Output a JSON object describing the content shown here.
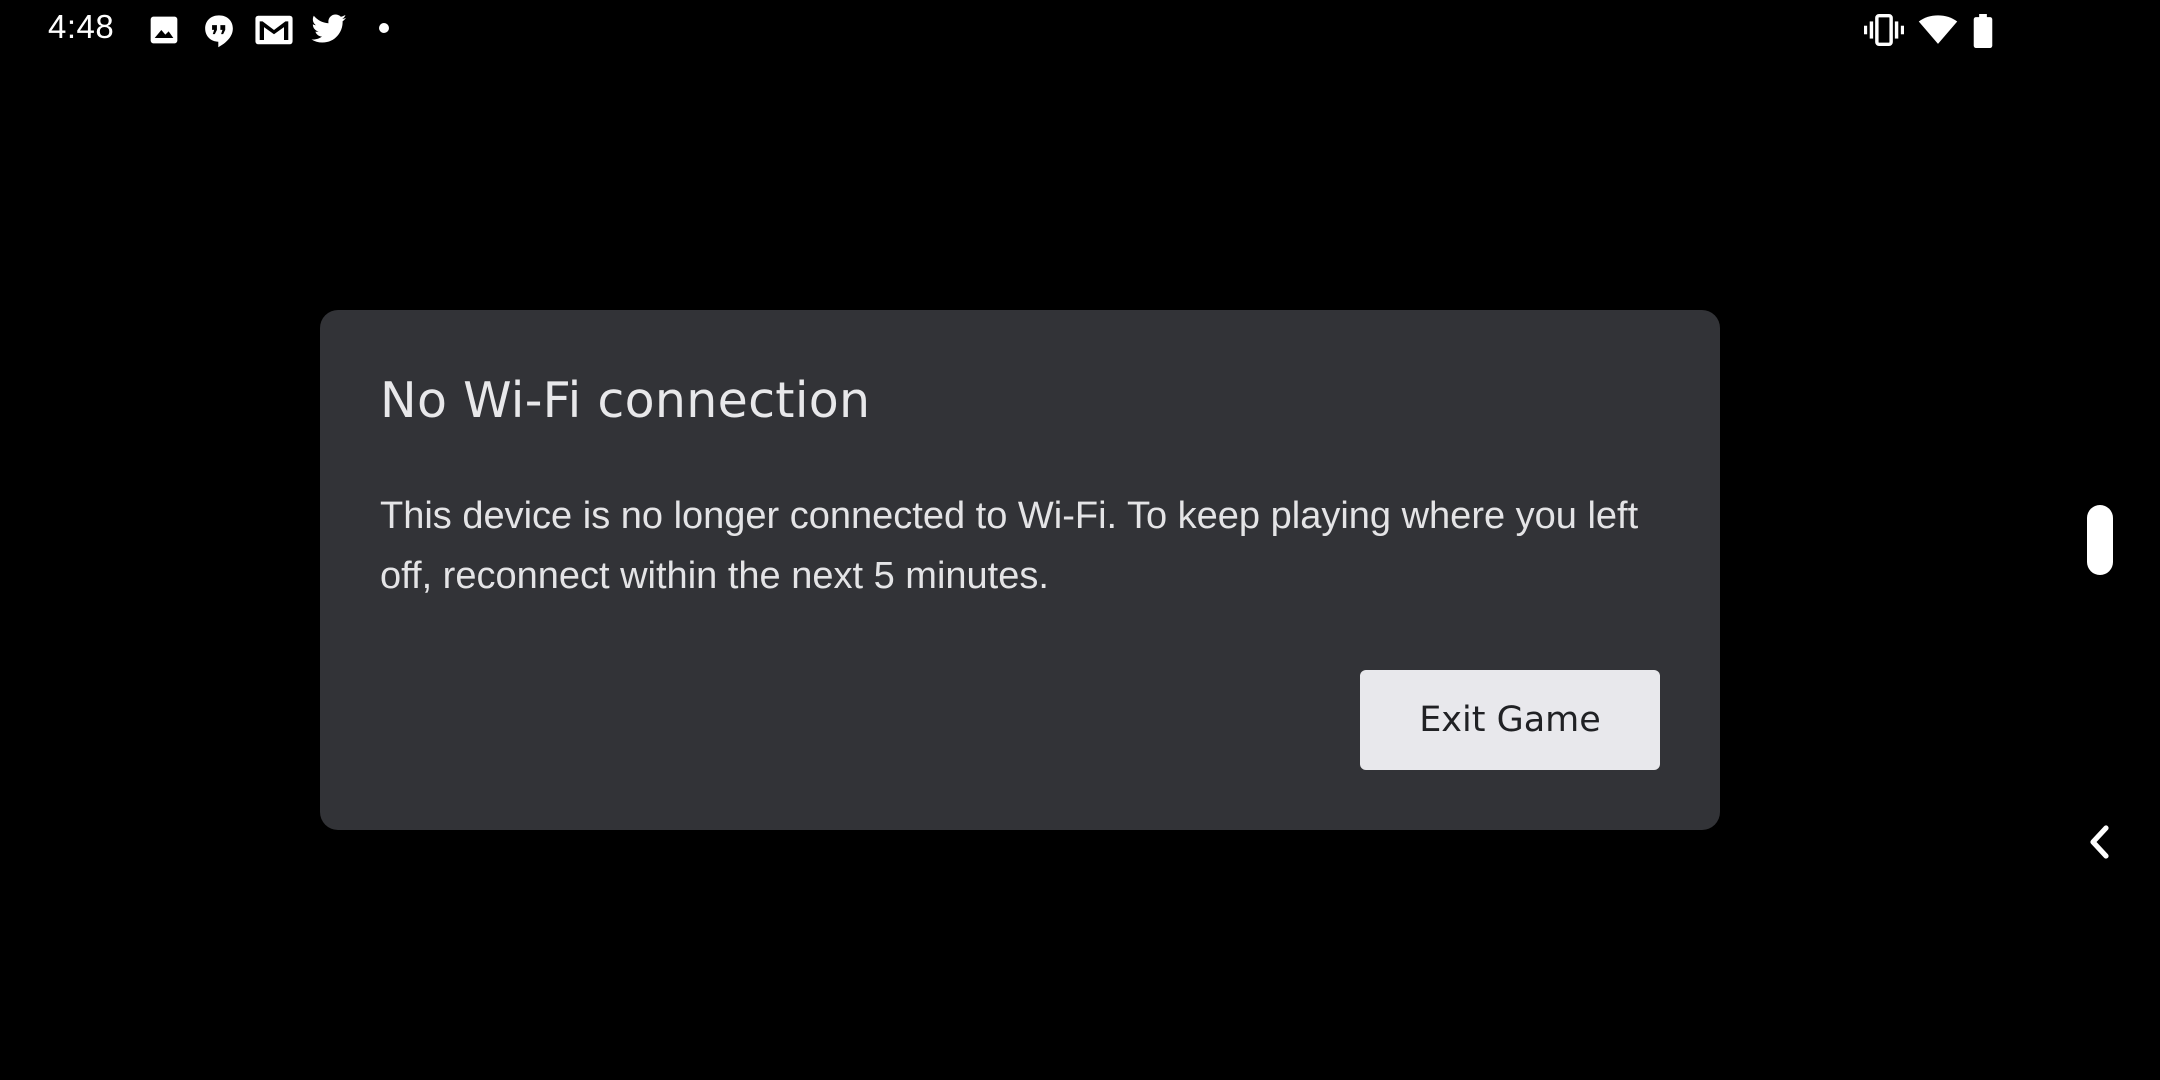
{
  "status_bar": {
    "time": "4:48",
    "notification_icons": [
      "image-icon",
      "hangouts-icon",
      "gmail-icon",
      "twitter-icon",
      "dot-icon"
    ],
    "system_icons": [
      "vibrate-icon",
      "wifi-icon",
      "battery-icon"
    ]
  },
  "dialog": {
    "title": "No Wi-Fi connection",
    "message": "This device is no longer connected to Wi-Fi. To keep playing where you left off, reconnect within the next 5 minutes.",
    "exit_button_label": "Exit Game"
  },
  "colors": {
    "background": "#000000",
    "dialog_background": "#323337",
    "button_background": "#e8e8ec",
    "text": "#e4e4e6"
  },
  "edge": {
    "handle": "scroll-handle",
    "back": "chevron-left-icon"
  }
}
